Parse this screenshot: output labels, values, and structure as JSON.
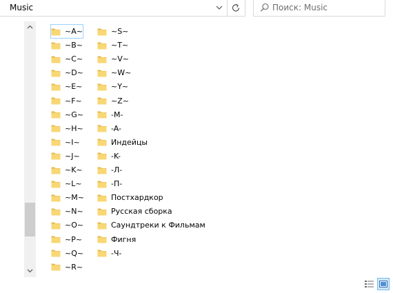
{
  "address": {
    "path": "Music"
  },
  "search": {
    "placeholder": "Поиск: Music"
  },
  "items_col1": [
    {
      "label": "~A~"
    },
    {
      "label": "~B~"
    },
    {
      "label": "~C~"
    },
    {
      "label": "~D~"
    },
    {
      "label": "~E~"
    },
    {
      "label": "~F~"
    },
    {
      "label": "~G~"
    },
    {
      "label": "~H~"
    },
    {
      "label": "~I~"
    },
    {
      "label": "~J~"
    },
    {
      "label": "~K~"
    },
    {
      "label": "~L~"
    },
    {
      "label": "~M~"
    },
    {
      "label": "~N~"
    },
    {
      "label": "~O~"
    },
    {
      "label": "~P~"
    },
    {
      "label": "~Q~"
    },
    {
      "label": "~R~"
    }
  ],
  "items_col2": [
    {
      "label": "~S~"
    },
    {
      "label": "~T~"
    },
    {
      "label": "~V~"
    },
    {
      "label": "~W~"
    },
    {
      "label": "~Y~"
    },
    {
      "label": "~Z~"
    },
    {
      "label": "-M-"
    },
    {
      "label": "-A-"
    },
    {
      "label": "Индейцы"
    },
    {
      "label": "-K-"
    },
    {
      "label": "-Л-"
    },
    {
      "label": "-П-"
    },
    {
      "label": "Постхардкор"
    },
    {
      "label": "Русская сборка"
    },
    {
      "label": "Саундтреки к Фильмам"
    },
    {
      "label": "Фигня"
    },
    {
      "label": "-Ч-"
    }
  ],
  "colors": {
    "folder_body": "#f8d775",
    "folder_tab": "#e8b84a",
    "selection_outline": "#99d1ff"
  },
  "icons": {
    "address_dropdown": "chevron-down-icon",
    "refresh": "refresh-icon",
    "search": "search-icon",
    "folder": "folder-icon",
    "details_view": "details-view-icon",
    "large_icons_view": "large-icons-view-icon"
  }
}
